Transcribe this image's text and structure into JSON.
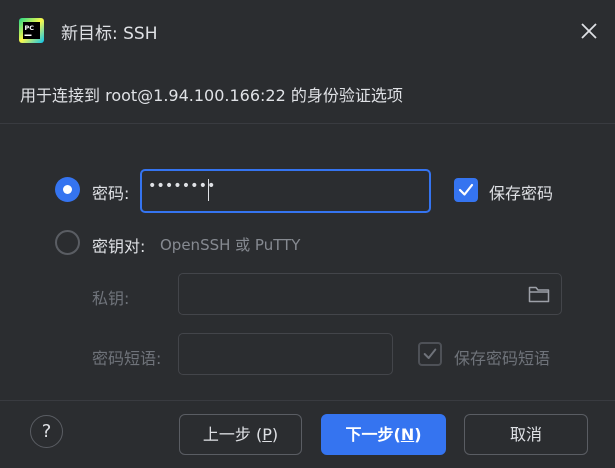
{
  "window": {
    "title": "新目标: SSH",
    "app_icon": "pycharm-icon",
    "close_icon": "close-icon"
  },
  "header": {
    "text": "用于连接到 root@1.94.100.166:22 的身份验证选项"
  },
  "auth": {
    "password_option": {
      "label": "密码:",
      "selected": true
    },
    "password_value": "••••••••",
    "save_password": {
      "label": "保存密码",
      "checked": true
    },
    "keypair_option": {
      "label": "密钥对:",
      "hint": "OpenSSH 或 PuTTY",
      "selected": false
    },
    "private_key": {
      "label": "私钥:",
      "value": "",
      "browse_icon": "folder-icon"
    },
    "passphrase": {
      "label": "密码短语:",
      "value": ""
    },
    "save_passphrase": {
      "label": "保存密码短语",
      "checked": true,
      "disabled": true
    }
  },
  "footer": {
    "help_label": "?",
    "prev": {
      "text": "上一步 (",
      "mnemonic": "P",
      "suffix": ")"
    },
    "next": {
      "text": "下一步(",
      "mnemonic": "N",
      "suffix": ")"
    },
    "cancel": "取消"
  },
  "colors": {
    "background": "#2b2d30",
    "accent": "#3574f0",
    "text": "#dfe1e5",
    "muted": "#6f737a"
  }
}
